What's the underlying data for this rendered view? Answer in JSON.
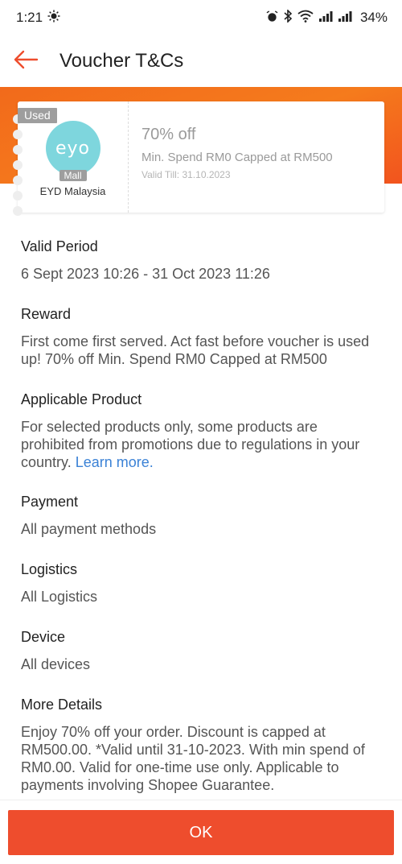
{
  "status_bar": {
    "time": "1:21",
    "battery": "34%",
    "icons": [
      "sun-icon",
      "alarm-icon",
      "bluetooth-icon",
      "wifi-icon",
      "signal-icon",
      "signal-icon"
    ]
  },
  "header": {
    "title": "Voucher T&Cs"
  },
  "voucher": {
    "used_tag": "Used",
    "logo_text": "eyo",
    "mall_tag": "Mall",
    "shop_name": "EYD Malaysia",
    "discount": "70% off",
    "min_spend": "Min. Spend RM0 Capped at RM500",
    "valid_till": "Valid Till: 31.10.2023"
  },
  "sections": {
    "valid_period": {
      "title": "Valid Period",
      "text": "6 Sept 2023 10:26 - 31 Oct 2023 11:26"
    },
    "reward": {
      "title": "Reward",
      "text": "First come first served. Act fast before voucher is used up! 70% off Min. Spend RM0 Capped at RM500"
    },
    "applicable_product": {
      "title": "Applicable Product",
      "text": "For selected products only, some products are prohibited from promotions due to regulations in your country.",
      "link": "Learn more."
    },
    "payment": {
      "title": "Payment",
      "text": "All payment methods"
    },
    "logistics": {
      "title": "Logistics",
      "text": "All Logistics"
    },
    "device": {
      "title": "Device",
      "text": "All devices"
    },
    "more_details": {
      "title": "More Details",
      "text": "Enjoy 70% off your order. Discount is capped at RM500.00. *Valid until 31-10-2023. With min spend of RM0.00. Valid for one-time use only. Applicable to payments involving Shopee Guarantee."
    }
  },
  "ok_button": {
    "label": "OK"
  },
  "colors": {
    "brand": "#ee4d2d",
    "band_orange": "#f57b1c",
    "link": "#3b82d6",
    "logo_bg": "#7ed6dd"
  }
}
